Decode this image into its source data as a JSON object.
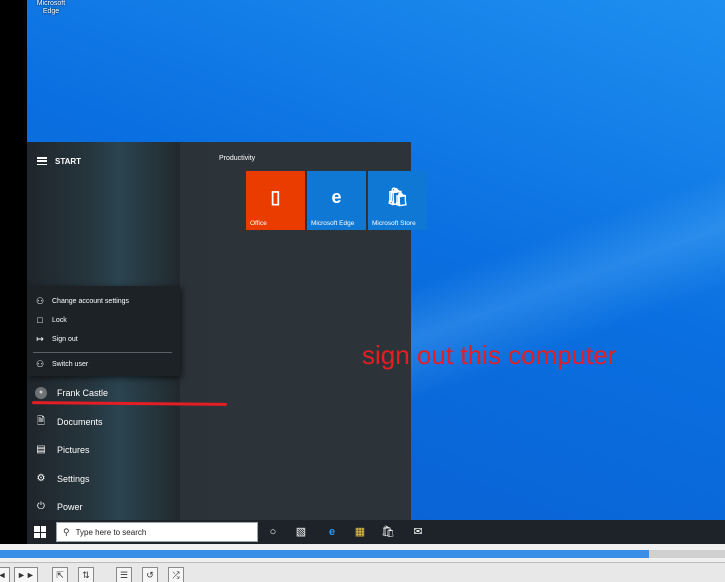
{
  "desktop": {
    "icon_label": "Microsoft Edge",
    "overlay_text": "sign out this computer",
    "overlay_color": "#e31e24"
  },
  "start_menu": {
    "title": "START",
    "account_popup": [
      {
        "label": "Change account settings",
        "icon": "person-gear-icon"
      },
      {
        "label": "Lock",
        "icon": "lock-icon"
      },
      {
        "label": "Sign out",
        "icon": "sign-out-icon"
      },
      {
        "label": "Switch user",
        "icon": "switch-user-icon"
      }
    ],
    "user_name": "Frank Castle",
    "left_items": [
      {
        "label": "Documents",
        "icon": "document-icon"
      },
      {
        "label": "Pictures",
        "icon": "pictures-icon"
      },
      {
        "label": "Settings",
        "icon": "gear-icon"
      },
      {
        "label": "Power",
        "icon": "power-icon"
      }
    ],
    "group_label": "Productivity",
    "tiles": [
      {
        "label": "Office",
        "color": "#eb3c00",
        "icon": "office-icon"
      },
      {
        "label": "Microsoft Edge",
        "color": "#0f78d4",
        "icon": "edge-icon"
      },
      {
        "label": "Microsoft Store",
        "color": "#0f78d4",
        "icon": "store-icon"
      }
    ]
  },
  "taskbar": {
    "search_placeholder": "Type here to search",
    "icons": [
      "cortana-icon",
      "task-view-icon",
      "edge-icon",
      "file-explorer-icon",
      "store-icon",
      "mail-icon"
    ]
  },
  "player": {
    "progress": 0.895,
    "accent": "#3b8ee6"
  }
}
